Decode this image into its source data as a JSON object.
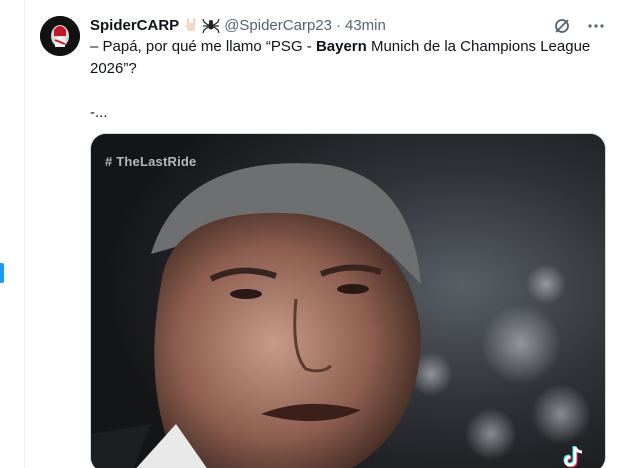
{
  "tweet": {
    "display_name": "SpiderCARP",
    "name_emojis": [
      "rock-hand-emoji",
      "spider-emoji"
    ],
    "handle": "@SpiderCarp23",
    "separator": "·",
    "time": "43min",
    "text": {
      "line1_pre": "– Papá, por qué me llamo “PSG - ",
      "line1_bold": "Bayern",
      "line1_post": " Munich de la Champions League",
      "line2": "2026”?",
      "line3": "-..."
    },
    "media": {
      "watermark": "# TheLastRide",
      "logo": "tiktok-logo"
    },
    "actions": {
      "grok_icon": "grok-icon",
      "more_icon": "more-icon"
    }
  },
  "colors": {
    "primary_text": "#0f1419",
    "secondary_text": "#536471",
    "accent": "#1d9bf0"
  }
}
